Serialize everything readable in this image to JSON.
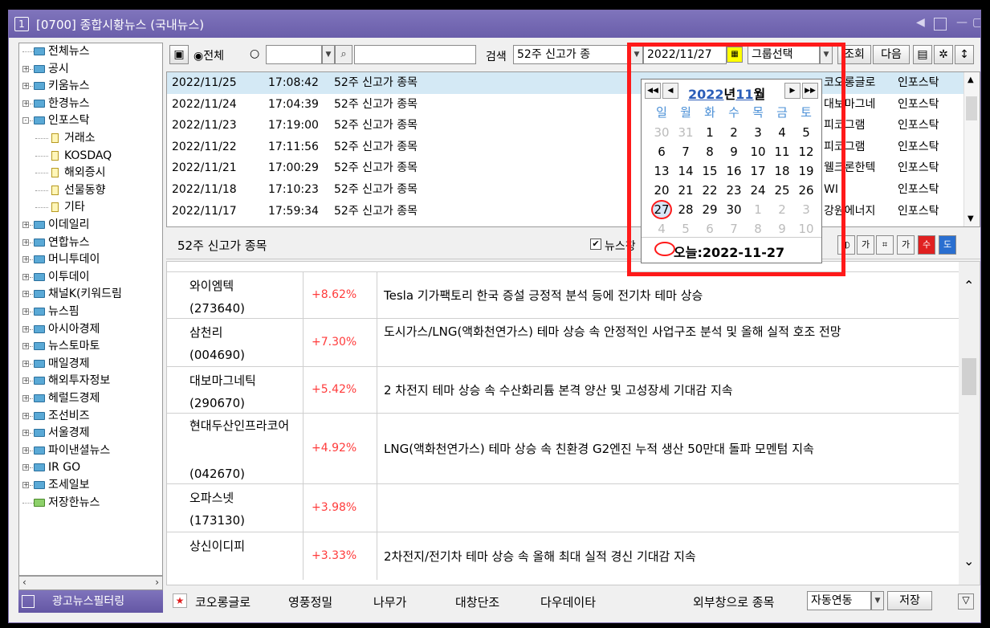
{
  "window": {
    "num": "1",
    "title": "[0700] 종합시황뉴스 (국내뉴스)"
  },
  "tree": {
    "items": [
      {
        "label": "전체뉴스",
        "kind": "folder",
        "exp": ""
      },
      {
        "label": "공시",
        "kind": "folder",
        "exp": "+"
      },
      {
        "label": "키움뉴스",
        "kind": "folder",
        "exp": "+"
      },
      {
        "label": "한경뉴스",
        "kind": "folder",
        "exp": "+"
      },
      {
        "label": "인포스탁",
        "kind": "folder-open",
        "exp": "-"
      },
      {
        "label": "거래소",
        "kind": "doc",
        "exp": ""
      },
      {
        "label": "KOSDAQ",
        "kind": "doc",
        "exp": ""
      },
      {
        "label": "해외증시",
        "kind": "doc",
        "exp": ""
      },
      {
        "label": "선물동향",
        "kind": "doc",
        "exp": ""
      },
      {
        "label": "기타",
        "kind": "doc",
        "exp": ""
      },
      {
        "label": "이데일리",
        "kind": "folder",
        "exp": "+"
      },
      {
        "label": "연합뉴스",
        "kind": "folder",
        "exp": "+"
      },
      {
        "label": "머니투데이",
        "kind": "folder",
        "exp": "+"
      },
      {
        "label": "이투데이",
        "kind": "folder",
        "exp": "+"
      },
      {
        "label": "채널K(키워드림",
        "kind": "folder",
        "exp": "+"
      },
      {
        "label": "뉴스핌",
        "kind": "folder",
        "exp": "+"
      },
      {
        "label": "아시아경제",
        "kind": "folder",
        "exp": "+"
      },
      {
        "label": "뉴스토마토",
        "kind": "folder",
        "exp": "+"
      },
      {
        "label": "매일경제",
        "kind": "folder",
        "exp": "+"
      },
      {
        "label": "해외투자정보",
        "kind": "folder",
        "exp": "+"
      },
      {
        "label": "헤럴드경제",
        "kind": "folder",
        "exp": "+"
      },
      {
        "label": "조선비즈",
        "kind": "folder",
        "exp": "+"
      },
      {
        "label": "서울경제",
        "kind": "folder",
        "exp": "+"
      },
      {
        "label": "파이낸셜뉴스",
        "kind": "folder",
        "exp": "+"
      },
      {
        "label": "IR GO",
        "kind": "folder",
        "exp": "+"
      },
      {
        "label": "조세일보",
        "kind": "folder",
        "exp": "+"
      },
      {
        "label": "저장한뉴스",
        "kind": "folder",
        "exp": ""
      }
    ],
    "filter_button": "광고뉴스필터링"
  },
  "toolbar": {
    "radio_all": "◉전체",
    "radio_other": "○",
    "search_label": "검색",
    "search_value": "52주 신고가 종",
    "date_value": "2022/11/27",
    "group_select": "그룹선택",
    "query_button": "조회",
    "next_button": "다음"
  },
  "list": {
    "rows": [
      {
        "date": "2022/11/25",
        "time": "17:08:42",
        "title": "52주 신고가 종목",
        "stock": "코오롱글로",
        "source": "인포스탁"
      },
      {
        "date": "2022/11/24",
        "time": "17:04:39",
        "title": "52주 신고가 종목",
        "stock": "대보마그네",
        "source": "인포스탁"
      },
      {
        "date": "2022/11/23",
        "time": "17:19:00",
        "title": "52주 신고가 종목",
        "stock": "피코그램",
        "source": "인포스탁"
      },
      {
        "date": "2022/11/22",
        "time": "17:11:56",
        "title": "52주 신고가 종목",
        "stock": "피코그램",
        "source": "인포스탁"
      },
      {
        "date": "2022/11/21",
        "time": "17:00:29",
        "title": "52주 신고가 종목",
        "stock": "웰크론한텍",
        "source": "인포스탁"
      },
      {
        "date": "2022/11/18",
        "time": "17:10:23",
        "title": "52주 신고가 종목",
        "stock": "WI",
        "source": "인포스탁"
      },
      {
        "date": "2022/11/17",
        "time": "17:59:34",
        "title": "52주 신고가 종목",
        "stock": "강원에너지",
        "source": "인포스탁"
      }
    ]
  },
  "detail": {
    "title": "52주 신고가 종목",
    "check_label": "뉴스창",
    "rows": [
      {
        "name": "와이엠텍",
        "code": "(273640)",
        "pct": "+8.62%",
        "desc": "Tesla 기가팩토리 한국 증설 긍정적 분석 등에 전기차 테마 상승"
      },
      {
        "name": "삼천리",
        "code": "(004690)",
        "pct": "+7.30%",
        "desc": "도시가스/LNG(액화천연가스) 테마 상승 속 안정적인 사업구조 분석 및 올해 실적 호조 전망"
      },
      {
        "name": "대보마그네틱",
        "code": "(290670)",
        "pct": "+5.42%",
        "desc": "2 차전지 테마 상승 속 수산화리튬 본격 양산 및 고성장세 기대감 지속"
      },
      {
        "name": "현대두산인프라코어",
        "code": "(042670)",
        "pct": "+4.92%",
        "desc": "LNG(액화천연가스) 테마 상승 속 친환경 G2엔진 누적 생산 50만대 돌파 모멘텀 지속"
      },
      {
        "name": "오파스넷",
        "code": "(173130)",
        "pct": "+3.98%",
        "desc": ""
      },
      {
        "name": "상신이디피",
        "code": "",
        "pct": "+3.33%",
        "desc": "2차전지/전기차 테마 상승 속 올해 최대 실적 경신 기대감 지속"
      }
    ]
  },
  "calendar": {
    "year": "2022",
    "year_suffix": "년",
    "month": "11",
    "month_suffix": "월",
    "weekdays": [
      "일",
      "월",
      "화",
      "수",
      "목",
      "금",
      "토"
    ],
    "weeks": [
      [
        "30",
        "31",
        "1",
        "2",
        "3",
        "4",
        "5"
      ],
      [
        "6",
        "7",
        "8",
        "9",
        "10",
        "11",
        "12"
      ],
      [
        "13",
        "14",
        "15",
        "16",
        "17",
        "18",
        "19"
      ],
      [
        "20",
        "21",
        "22",
        "23",
        "24",
        "25",
        "26"
      ],
      [
        "27",
        "28",
        "29",
        "30",
        "1",
        "2",
        "3"
      ],
      [
        "4",
        "5",
        "6",
        "7",
        "8",
        "9",
        "10"
      ]
    ],
    "today_label": "오늘:2022-11-27"
  },
  "bottom": {
    "items": [
      "코오롱글로",
      "영풍정밀",
      "나무가",
      "대창단조",
      "다우데이타"
    ],
    "ext_label": "외부창으로 종목",
    "auto_link": "자동연동",
    "save_button": "저장"
  },
  "colors": {
    "title_bar": "#7a6fb8",
    "highlight_box": "#ff1a1a",
    "up": "#ff3b3b",
    "selected_row": "#d4e9f5",
    "weekday": "#4a8fd6"
  }
}
